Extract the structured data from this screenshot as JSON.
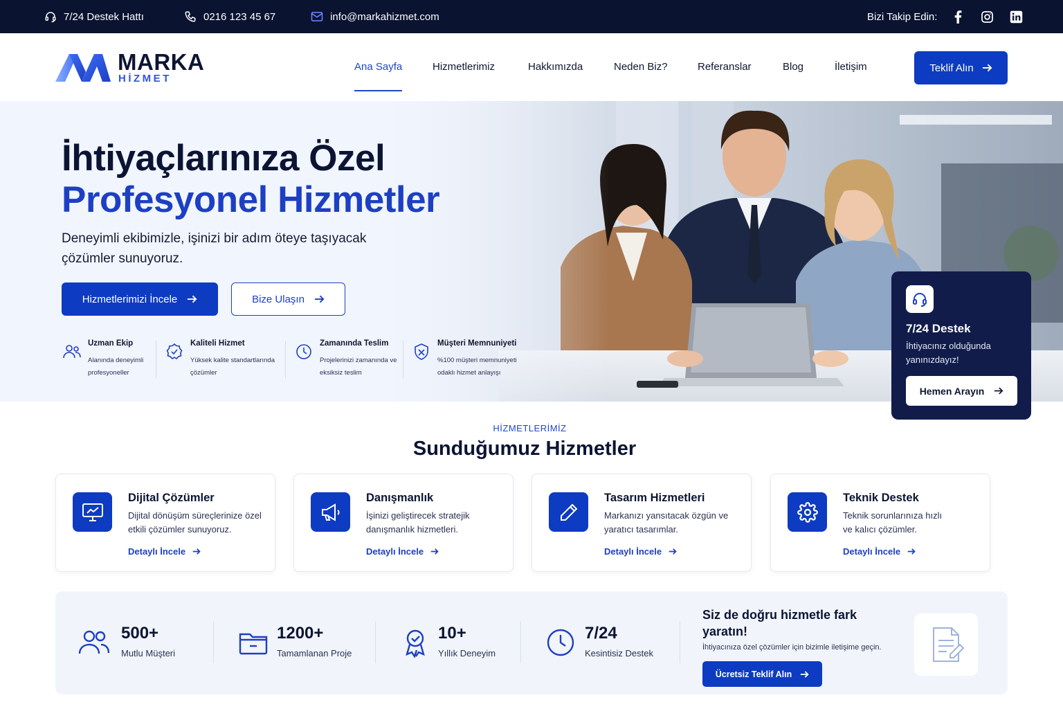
{
  "topbar": {
    "hotline": "7/24 Destek Hattı",
    "phone": "0216 123 45 67",
    "email": "info@markahizmet.com",
    "follow": "Bizi Takip Edin:",
    "social_icons": [
      "facebook-icon",
      "instagram-icon",
      "linkedin-icon"
    ]
  },
  "brand": {
    "name": "MARKA",
    "sub": "HİZMET"
  },
  "nav": {
    "items": [
      {
        "label": "Ana Sayfa",
        "active": true
      },
      {
        "label": "Hizmetlerimiz"
      },
      {
        "label": "Hakkımızda"
      },
      {
        "label": "Neden Biz?"
      },
      {
        "label": "Referanslar"
      },
      {
        "label": "Blog"
      },
      {
        "label": "İletişim"
      }
    ],
    "cta": "Teklif Alın"
  },
  "hero": {
    "title_line1": "İhtiyaçlarınıza Özel",
    "title_line2": "Profesyonel Hizmetler",
    "subtitle": "Deneyimli ekibimizle, işinizi bir adım öteye taşıyacak çözümler sunuyoruz.",
    "primary_button": "Hizmetlerimizi İncele",
    "secondary_button": "Bize Ulaşın",
    "features": [
      {
        "title": "Uzman Ekip",
        "desc": "Alanında deneyimli profesyoneller",
        "icon": "team-icon"
      },
      {
        "title": "Kaliteli Hizmet",
        "desc": "Yüksek kalite standartlarında çözümler",
        "icon": "quality-badge-icon"
      },
      {
        "title": "Zamanında Teslim",
        "desc": "Projelerinizi zamanında ve eksiksiz teslim",
        "icon": "clock-icon"
      },
      {
        "title": "Müşteri Memnuniyeti",
        "desc": "%100 müşteri memnuniyeti odaklı hizmet anlayışı",
        "icon": "shield-check-icon"
      }
    ]
  },
  "support_card": {
    "title": "7/24 Destek",
    "text": "İhtiyacınız olduğunda yanınızdayız!",
    "button": "Hemen Arayın"
  },
  "services": {
    "eyebrow": "HİZMETLERİMİZ",
    "heading": "Sunduğumuz Hizmetler",
    "cards": [
      {
        "title": "Dijital Çözümler",
        "desc": "Dijital dönüşüm süreçlerinize özel etkili çözümler sunuyoruz.",
        "link": "Detaylı İncele",
        "icon": "monitor-chart-icon"
      },
      {
        "title": "Danışmanlık",
        "desc": "İşinizi geliştirecek stratejik danışmanlık hizmetleri.",
        "link": "Detaylı İncele",
        "icon": "megaphone-icon"
      },
      {
        "title": "Tasarım Hizmetleri",
        "desc": "Markanızı yansıtacak özgün ve yaratıcı tasarımlar.",
        "link": "Detaylı İncele",
        "icon": "pencil-icon"
      },
      {
        "title": "Teknik Destek",
        "desc": "Teknik sorunlarınıza hızlı ve kalıcı çözümler.",
        "link": "Detaylı İncele",
        "icon": "gear-icon"
      }
    ]
  },
  "stats": {
    "items": [
      {
        "value": "500+",
        "label": "Mutlu Müşteri",
        "icon": "users-icon"
      },
      {
        "value": "1200+",
        "label": "Tamamlanan Proje",
        "icon": "folder-icon"
      },
      {
        "value": "10+",
        "label": "Yıllık Deneyim",
        "icon": "award-icon"
      },
      {
        "value": "7/24",
        "label": "Kesintisiz Destek",
        "icon": "clock-icon"
      }
    ],
    "cta_title": "Siz de doğru hizmetle fark yaratın!",
    "cta_text": "İhtiyacınıza özel çözümler için bizimle iletişime geçin.",
    "cta_button": "Ücretsiz Teklif Alın"
  },
  "colors": {
    "primary": "#0d3bc2",
    "accent_text": "#1d3fc4",
    "topbar_bg": "#0a1330",
    "support_bg": "#111c4a",
    "stats_bg": "#f1f5fb"
  }
}
